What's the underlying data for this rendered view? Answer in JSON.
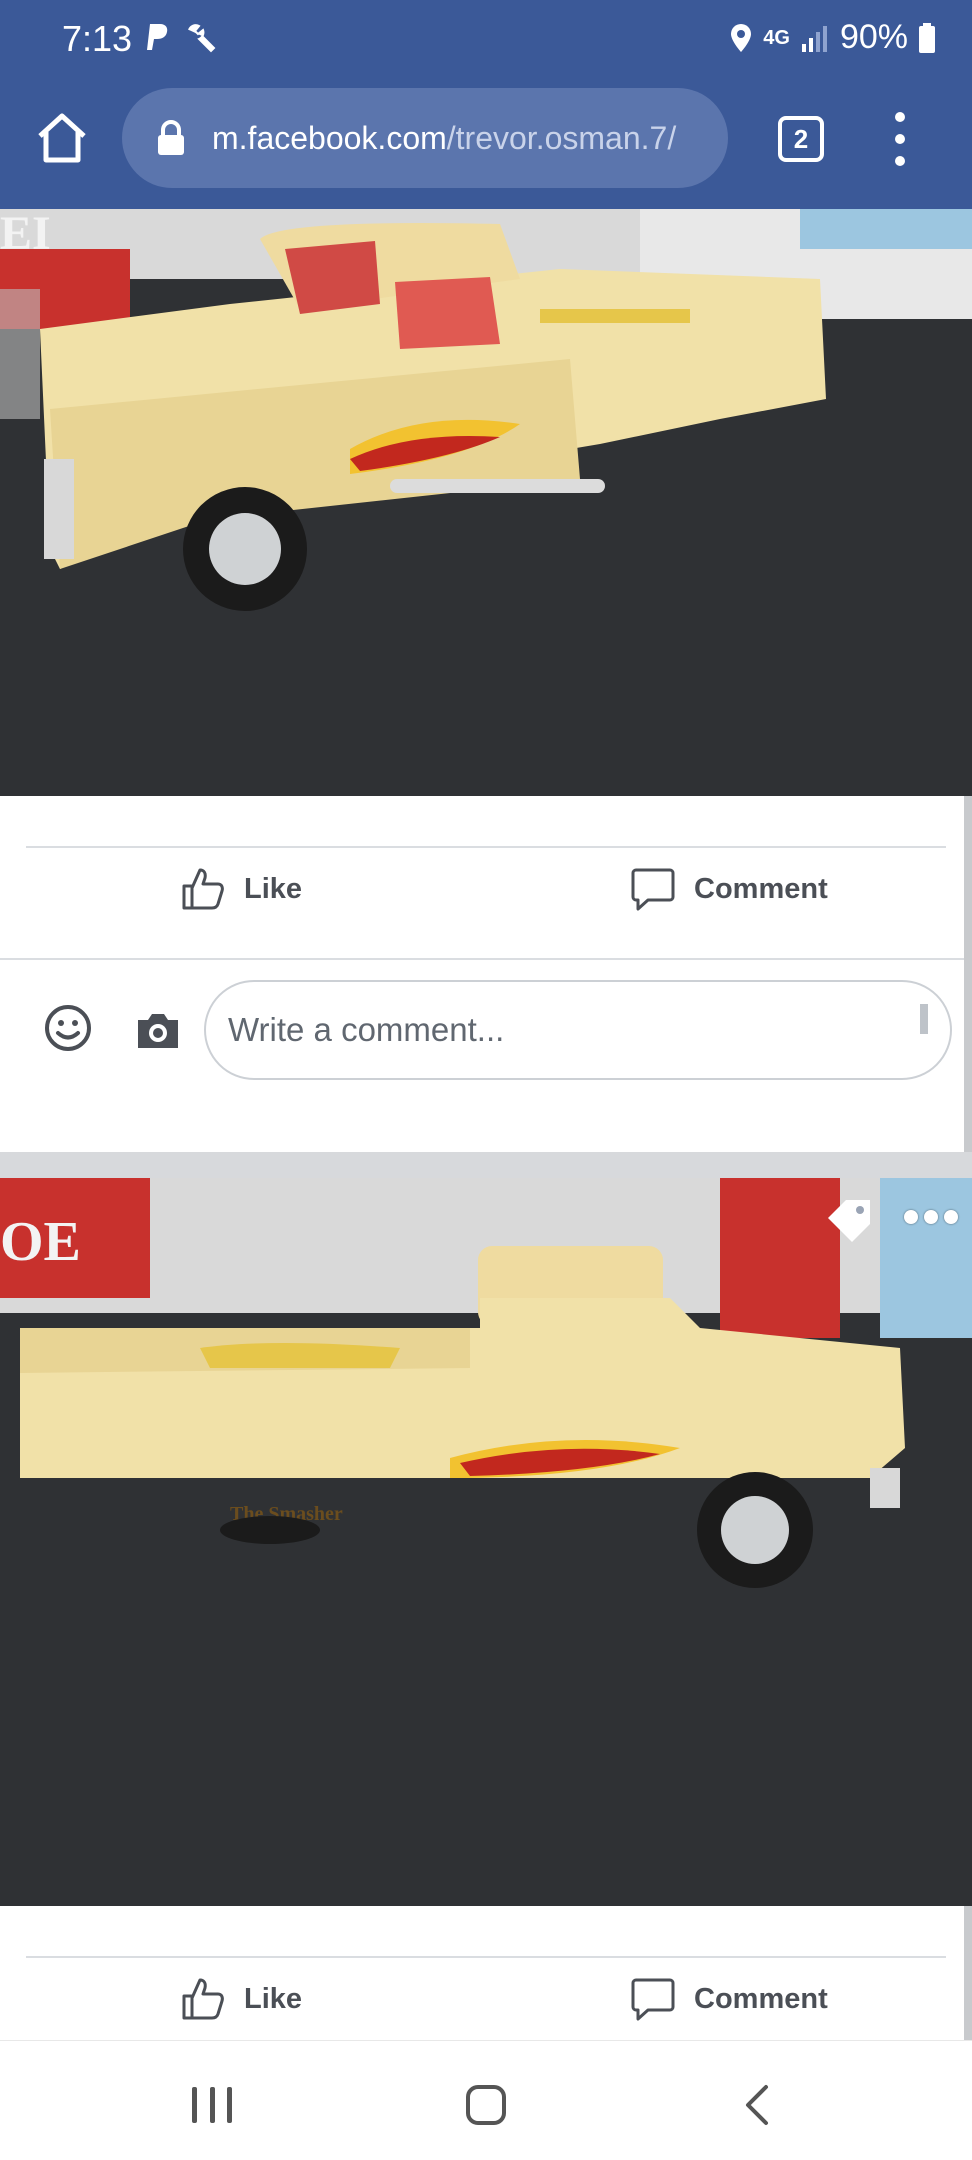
{
  "status_bar": {
    "time": "7:13",
    "network": "4G",
    "battery": "90%",
    "icons": [
      "paypal-icon",
      "wrench-icon",
      "location-icon",
      "signal-icon",
      "battery-icon"
    ]
  },
  "browser": {
    "url_host": "m.facebook.com",
    "url_path": "/trevor.osman.7/",
    "tab_count": "2"
  },
  "posts": [
    {
      "photo_alt": "Yellow toy pickup truck with flame decals",
      "actions": {
        "like": "Like",
        "comment": "Comment"
      },
      "comment_placeholder": "Write a comment..."
    },
    {
      "photo_alt": "Yellow toy pickup truck, side view",
      "decal_text": "The Smasher",
      "actions": {
        "like": "Like",
        "comment": "Comment"
      }
    }
  ],
  "colors": {
    "brand_blue": "#3b5998",
    "url_pill": "#5b75ad",
    "truck_yellow": "#f1e1a8",
    "table_dark": "#2f3134"
  }
}
